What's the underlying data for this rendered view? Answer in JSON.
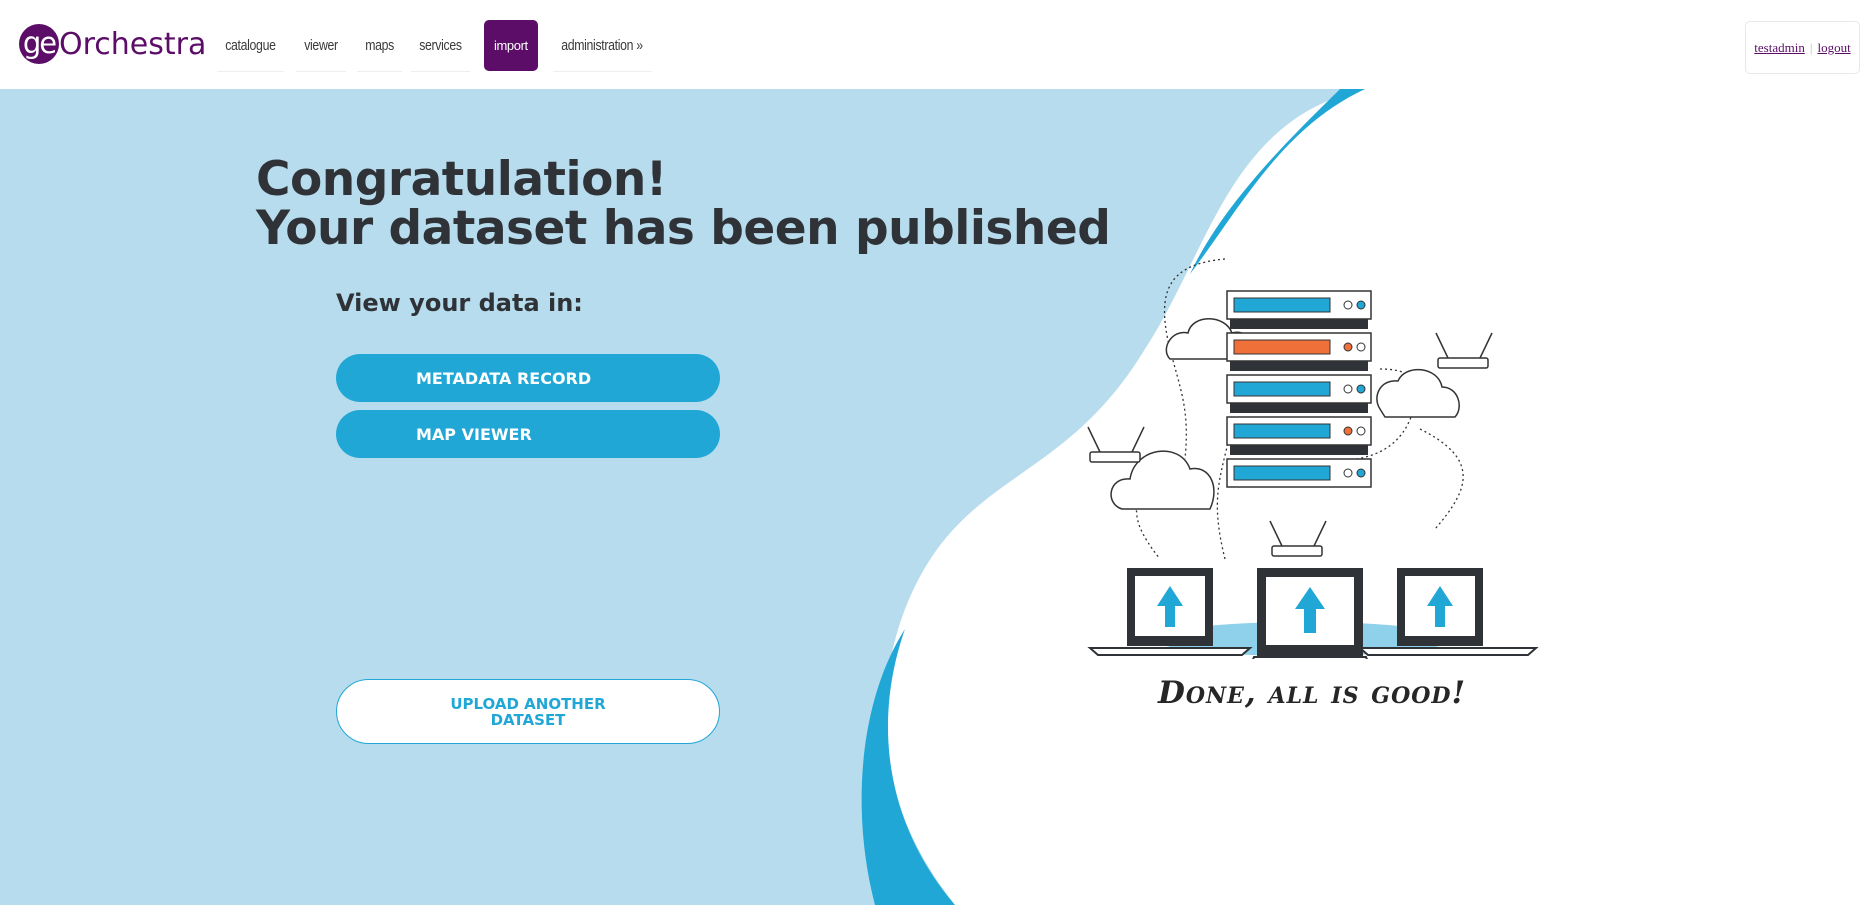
{
  "header": {
    "logo_prefix": "ge",
    "logo_name": "Orchestra",
    "nav": [
      {
        "label": "catalogue"
      },
      {
        "label": "viewer"
      },
      {
        "label": "maps"
      },
      {
        "label": "services"
      },
      {
        "label": "import",
        "active": true
      },
      {
        "label": "administration »"
      }
    ],
    "user": {
      "username": "testadmin",
      "logout_label": "logout"
    }
  },
  "main": {
    "title_line1": "Congratulation!",
    "title_line2": "Your dataset has been published",
    "view_label": "View your data in:",
    "metadata_button": "METADATA RECORD",
    "map_viewer_button": "MAP VIEWER",
    "upload_button_line1": "UPLOAD ANOTHER",
    "upload_button_line2": "DATASET",
    "done_text": "Done, all is good!"
  },
  "colors": {
    "brand": "#5b0d68",
    "accent": "#21a7d6",
    "hero_background": "#b7dced",
    "title_text": "#2f3338"
  },
  "icons": [
    "server-rack-icon",
    "cloud-icon",
    "router-icon",
    "laptop-upload-icon"
  ]
}
